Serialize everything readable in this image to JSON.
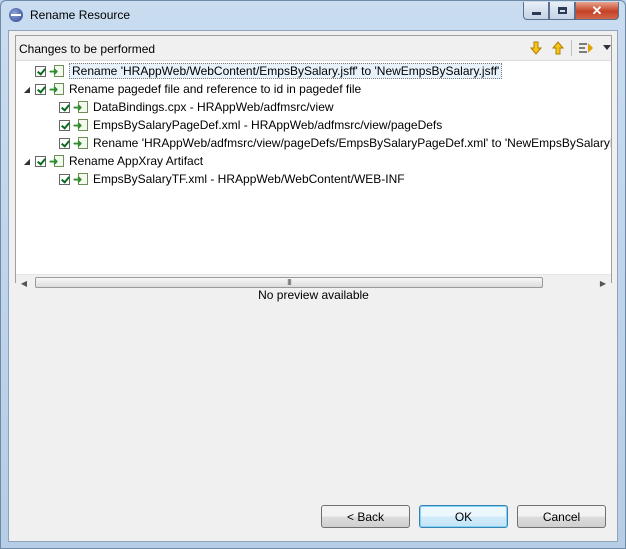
{
  "window": {
    "title": "Rename Resource",
    "close_glyph": "✕"
  },
  "panel": {
    "title": "Changes to be performed",
    "toolbar": {
      "next_icon": "arrow-down-icon",
      "prev_icon": "arrow-up-icon",
      "filter_icon": "filter-icon",
      "menu_icon": "dropdown-icon"
    },
    "tree": [
      {
        "label": "Rename 'HRAppWeb/WebContent/EmpsBySalary.jsff' to 'NewEmpsBySalary.jsff'",
        "checked": true,
        "level": 0,
        "expandable": false,
        "selected": true
      },
      {
        "label": "Rename pagedef file and reference to id in pagedef file",
        "checked": true,
        "level": 0,
        "expandable": true,
        "expanded": true
      },
      {
        "label": "DataBindings.cpx - HRAppWeb/adfmsrc/view",
        "checked": true,
        "level": 1
      },
      {
        "label": "EmpsBySalaryPageDef.xml - HRAppWeb/adfmsrc/view/pageDefs",
        "checked": true,
        "level": 1
      },
      {
        "label": "Rename 'HRAppWeb/adfmsrc/view/pageDefs/EmpsBySalaryPageDef.xml' to 'NewEmpsBySalaryPa",
        "checked": true,
        "level": 1
      },
      {
        "label": "Rename AppXray Artifact",
        "checked": true,
        "level": 0,
        "expandable": true,
        "expanded": true
      },
      {
        "label": "EmpsBySalaryTF.xml - HRAppWeb/WebContent/WEB-INF",
        "checked": true,
        "level": 1
      }
    ],
    "scrollbar_grip": "III"
  },
  "preview": {
    "text": "No preview available"
  },
  "buttons": {
    "back": "< Back",
    "ok": "OK",
    "cancel": "Cancel"
  }
}
